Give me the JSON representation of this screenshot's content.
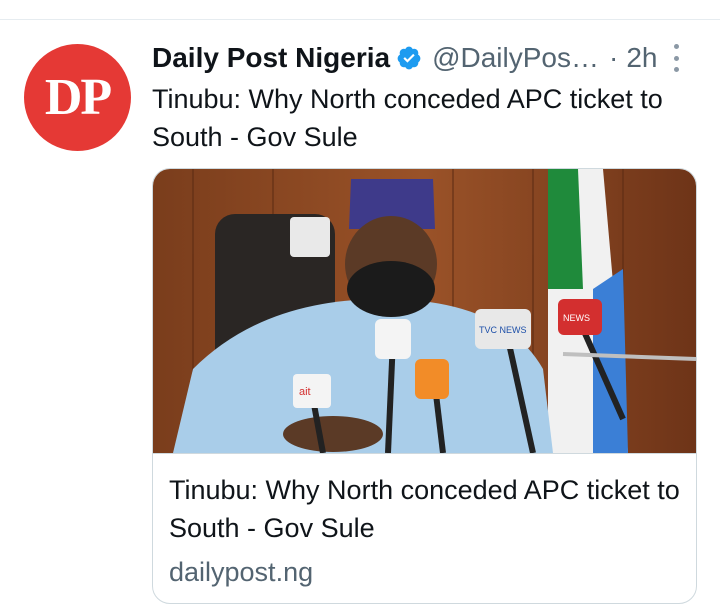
{
  "tweet": {
    "author_name": "Daily Post Nigeria",
    "handle": "@DailyPos…",
    "separator": "·",
    "time": "2h",
    "avatar_text": "DP",
    "text": "Tinubu: Why North conceded APC ticket to South - Gov Sule"
  },
  "card": {
    "title": "Tinubu: Why North conceded APC ticket to South - Gov Sule",
    "domain": "dailypost.ng",
    "mic_labels": [
      "ait",
      "TVC NEWS",
      "NEWS"
    ]
  },
  "colors": {
    "avatar_bg": "#e53935",
    "verified_badge": "#1d9bf0",
    "secondary_text": "#536471"
  },
  "icons": [
    "verified-badge-icon",
    "more-options-icon"
  ]
}
